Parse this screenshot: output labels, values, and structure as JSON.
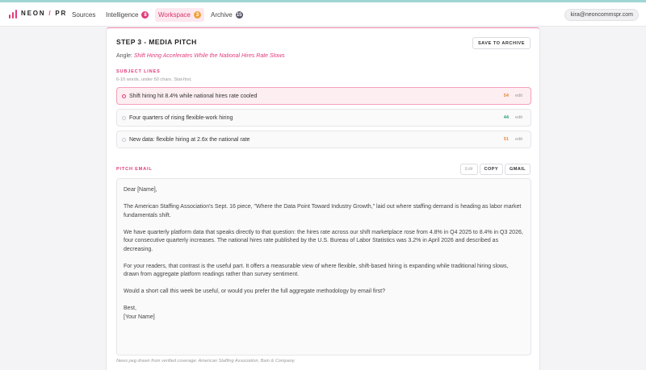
{
  "brand": {
    "name_left": "NEON",
    "slash": "/",
    "name_right": "PR"
  },
  "nav": {
    "sources": "Sources",
    "intelligence": {
      "label": "Intelligence",
      "count": "8",
      "color": "#e23b7c"
    },
    "workspace": {
      "label": "Workspace",
      "count": "3",
      "color": "#f0a33b"
    },
    "archive": {
      "label": "Archive",
      "count": "15",
      "color": "#555566"
    }
  },
  "user": {
    "email": "kira@neoncommspr.com"
  },
  "step": {
    "title": "STEP 3 - MEDIA PITCH",
    "save_label": "SAVE TO ARCHIVE"
  },
  "angle": {
    "label": "Angle:",
    "text": "Shift Hiring Accelerates While the National Hires Rate Slows"
  },
  "subject_lines": {
    "label": "SUBJECT LINES",
    "hint": "6-10 words, under 50 chars. Stat-first.",
    "items": [
      {
        "text": "Shift hiring hit 8.4% while national hires rate cooled",
        "count": "54",
        "count_color": "#e8893a",
        "edit": "edit",
        "selected": true
      },
      {
        "text": "Four quarters of rising flexible-work hiring",
        "count": "44",
        "count_color": "#2e9e6e",
        "edit": "edit",
        "selected": false
      },
      {
        "text": "New data: flexible hiring at 2.6x the national rate",
        "count": "51",
        "count_color": "#e8893a",
        "edit": "edit",
        "selected": false
      }
    ]
  },
  "pitch_email": {
    "label": "PITCH EMAIL",
    "edit_label": "Edit",
    "copy_label": "COPY",
    "gmail_label": "GMAIL",
    "paragraphs": [
      "Dear [Name],",
      "The American Staffing Association's Sept. 16 piece, \"Where the Data Point Toward Industry Growth,\" laid out where staffing demand is heading as labor market fundamentals shift.",
      "We have quarterly platform data that speaks directly to that question: the hires rate across our shift marketplace rose from 4.8% in Q4 2025 to 8.4% in Q3 2026, four consecutive quarterly increases. The national hires rate published by the U.S. Bureau of Labor Statistics was 3.2% in April 2026 and described as decreasing.",
      "For your readers, that contrast is the useful part. It offers a measurable view of where flexible, shift-based hiring is expanding while traditional hiring slows, drawn from aggregate platform readings rather than survey sentiment.",
      "Would a short call this week be useful, or would you prefer the full aggregate methodology by email first?"
    ],
    "signoff": "Best,",
    "signature": "[Your Name]",
    "footnote": "News peg drawn from verified coverage: American Staffing Association, Bain & Company."
  }
}
